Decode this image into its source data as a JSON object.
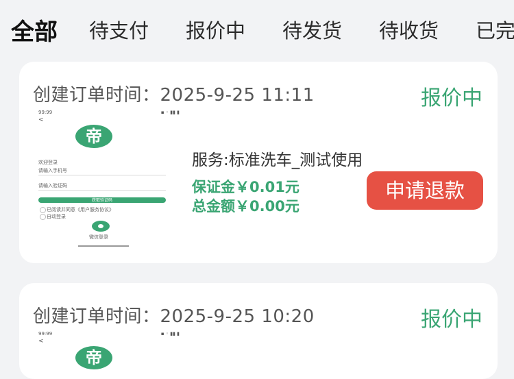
{
  "tabs": [
    "全部",
    "待支付",
    "报价中",
    "待发货",
    "待收货",
    "已完"
  ],
  "orders": [
    {
      "time_label": "创建订单时间：2025-9-25 11:11",
      "status": "报价中",
      "service": "服务:标准洗车_测试使用",
      "deposit": "保证金￥0.01元",
      "total": "总金额￥0.00元",
      "refund_label": "申请退款",
      "thumb": {
        "title": "欢迎登录",
        "phone_placeholder": "请输入手机号",
        "password_placeholder": "请输入验证码",
        "login_button": "获取验证码",
        "agree_text": "已阅读并同意《用户服务协议》",
        "auto_login": "自动登录",
        "wechat_login": "微信登录"
      }
    },
    {
      "time_label": "创建订单时间：2025-9-25 10:20",
      "status": "报价中"
    }
  ],
  "colors": {
    "accent": "#3aa573",
    "refund": "#e65144",
    "background": "#f2f3f5"
  }
}
